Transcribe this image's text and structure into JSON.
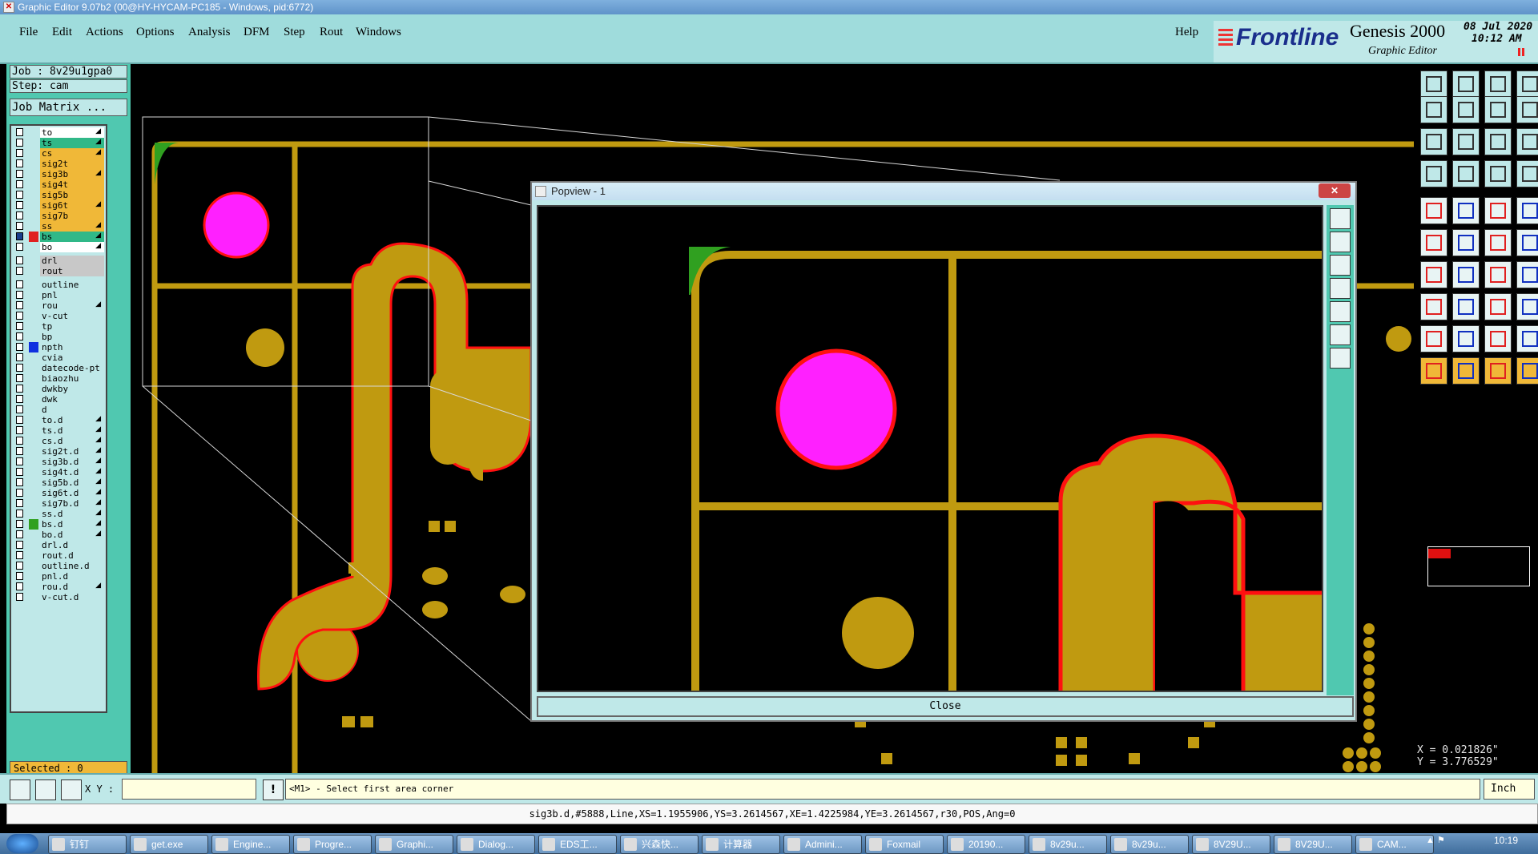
{
  "window": {
    "title": "Graphic Editor 9.07b2 (00@HY-HYCAM-PC185 - Windows, pid:6772)"
  },
  "menu": {
    "items": [
      "File",
      "Edit",
      "Actions",
      "Options",
      "Analysis",
      "DFM",
      "Step",
      "Rout",
      "Windows"
    ],
    "help": "Help"
  },
  "brand": {
    "logo": "Frontline",
    "product": "Genesis 2000",
    "subtitle": "Graphic Editor",
    "date": "08 Jul 2020",
    "time": "10:12 AM"
  },
  "job": {
    "job_label": "Job : 8v29u1gpa0",
    "step_label": "Step: cam",
    "matrix_button": "Job Matrix ..."
  },
  "layers": [
    {
      "name": "to",
      "color": "#ffffff",
      "arrow": true
    },
    {
      "name": "ts",
      "color": "#30b888",
      "arrow": true
    },
    {
      "name": "cs",
      "color": "#f0b838",
      "arrow": true
    },
    {
      "name": "sig2t",
      "color": "#f0b838",
      "arrow": false
    },
    {
      "name": "sig3b",
      "color": "#f0b838",
      "arrow": true
    },
    {
      "name": "sig4t",
      "color": "#f0b838",
      "arrow": false
    },
    {
      "name": "sig5b",
      "color": "#f0b838",
      "arrow": false
    },
    {
      "name": "sig6t",
      "color": "#f0b838",
      "arrow": true
    },
    {
      "name": "sig7b",
      "color": "#f0b838",
      "arrow": false
    },
    {
      "name": "ss",
      "color": "#f0b838",
      "arrow": true
    },
    {
      "name": "bs",
      "color": "#30b888",
      "arrow": true,
      "marker": "#e02020",
      "checked": true
    },
    {
      "name": "bo",
      "color": "#ffffff",
      "arrow": true
    },
    {
      "name": "drl",
      "color": "#c8c8c8",
      "arrow": false,
      "gap": true
    },
    {
      "name": "rout",
      "color": "#c8c8c8",
      "arrow": false
    },
    {
      "name": "outline",
      "color": "#bfe8e8",
      "arrow": false,
      "gap": true
    },
    {
      "name": "pnl",
      "color": "#bfe8e8",
      "arrow": false
    },
    {
      "name": "rou",
      "color": "#bfe8e8",
      "arrow": true
    },
    {
      "name": "v-cut",
      "color": "#bfe8e8",
      "arrow": false
    },
    {
      "name": "tp",
      "color": "#bfe8e8",
      "arrow": false
    },
    {
      "name": "bp",
      "color": "#bfe8e8",
      "arrow": false
    },
    {
      "name": "npth",
      "color": "#bfe8e8",
      "arrow": false,
      "marker": "#1030e0"
    },
    {
      "name": "cvia",
      "color": "#bfe8e8",
      "arrow": false
    },
    {
      "name": "datecode-pt",
      "color": "#bfe8e8",
      "arrow": false
    },
    {
      "name": "biaozhu",
      "color": "#bfe8e8",
      "arrow": false
    },
    {
      "name": "dwkby",
      "color": "#bfe8e8",
      "arrow": false
    },
    {
      "name": "dwk",
      "color": "#bfe8e8",
      "arrow": false
    },
    {
      "name": "d",
      "color": "#bfe8e8",
      "arrow": false
    },
    {
      "name": "to.d",
      "color": "#bfe8e8",
      "arrow": true
    },
    {
      "name": "ts.d",
      "color": "#bfe8e8",
      "arrow": true
    },
    {
      "name": "cs.d",
      "color": "#bfe8e8",
      "arrow": true
    },
    {
      "name": "sig2t.d",
      "color": "#bfe8e8",
      "arrow": true
    },
    {
      "name": "sig3b.d",
      "color": "#bfe8e8",
      "arrow": true
    },
    {
      "name": "sig4t.d",
      "color": "#bfe8e8",
      "arrow": true
    },
    {
      "name": "sig5b.d",
      "color": "#bfe8e8",
      "arrow": true
    },
    {
      "name": "sig6t.d",
      "color": "#bfe8e8",
      "arrow": true
    },
    {
      "name": "sig7b.d",
      "color": "#bfe8e8",
      "arrow": true
    },
    {
      "name": "ss.d",
      "color": "#bfe8e8",
      "arrow": true
    },
    {
      "name": "bs.d",
      "color": "#bfe8e8",
      "arrow": true,
      "marker": "#30a020"
    },
    {
      "name": "bo.d",
      "color": "#bfe8e8",
      "arrow": true
    },
    {
      "name": "drl.d",
      "color": "#bfe8e8",
      "arrow": false
    },
    {
      "name": "rout.d",
      "color": "#bfe8e8",
      "arrow": false
    },
    {
      "name": "outline.d",
      "color": "#bfe8e8",
      "arrow": false
    },
    {
      "name": "pnl.d",
      "color": "#bfe8e8",
      "arrow": false
    },
    {
      "name": "rou.d",
      "color": "#bfe8e8",
      "arrow": true
    },
    {
      "name": "v-cut.d",
      "color": "#bfe8e8",
      "arrow": false
    }
  ],
  "selected": "Selected : 0",
  "popview": {
    "title": "Popview - 1",
    "close_label": "Close"
  },
  "coords": {
    "x": "X = 0.021826\"",
    "y": "Y = 3.776529\""
  },
  "bottom": {
    "xy_label": "X Y :",
    "xy_value": "",
    "prompt": "<M1> - Select first area corner",
    "units": "Inch"
  },
  "status": "sig3b.d,#5888,Line,XS=1.1955906,YS=3.2614567,XE=1.4225984,YE=3.2614567,r30,POS,Ang=0",
  "taskbar": {
    "clock": "10:19",
    "items": [
      "钉钉",
      "get.exe",
      "Engine...",
      "Progre...",
      "Graphi...",
      "Dialog...",
      "EDS工...",
      "兴森快...",
      "计算器",
      "Admini...",
      "Foxmail",
      "20190...",
      "8v29u...",
      "8v29u...",
      "8V29U...",
      "8V29U...",
      "CAM..."
    ]
  },
  "colors": {
    "copper": "#c09a10",
    "outline_red": "#ff1010",
    "magenta": "#ff20ff",
    "green": "#30a020",
    "panel": "#50c8b0",
    "panel_light": "#bfe8e8"
  }
}
